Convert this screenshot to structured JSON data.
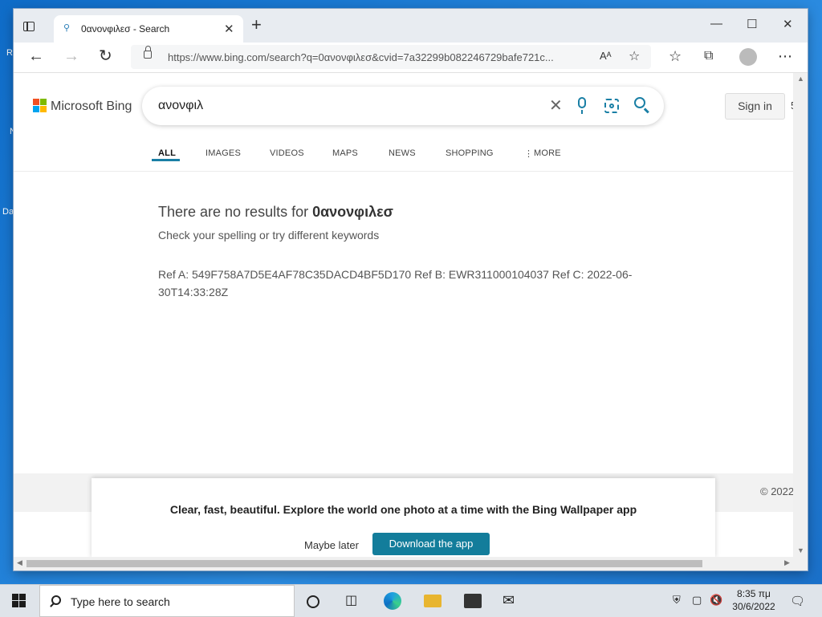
{
  "desktop": {
    "icon_labels": [
      "R",
      "N",
      "Da"
    ]
  },
  "browser": {
    "tab_title": "0ανονφιλεσ - Search",
    "url": "https://www.bing.com/search?q=0ανονφιλεσ&cvid=7a32299b082246729bafe721c...",
    "read_aloud": "Aᴬ"
  },
  "bing": {
    "logo_text": "Microsoft Bing",
    "logo_colors": [
      "#f25022",
      "#7fba00",
      "#00a4ef",
      "#ffb900"
    ],
    "search_query": "ανονφιλ",
    "sign_in": "Sign in",
    "sign_in_extra": "5",
    "nav": [
      "ALL",
      "IMAGES",
      "VIDEOS",
      "MAPS",
      "NEWS",
      "SHOPPING",
      "MORE"
    ],
    "no_results_prefix": "There are no results for ",
    "no_results_query": "0ανονφιλεσ",
    "hint": "Check your spelling or try different keywords",
    "ref_text": "Ref A: 549F758A7D5E4AF78C35DACD4BF5D170 Ref B: EWR311000104037 Ref C: 2022-06-30T14:33:28Z",
    "footer_copy": "© 2022"
  },
  "promo": {
    "text": "Clear, fast, beautiful. Explore the world one photo at a time with the Bing Wallpaper app",
    "maybe_later": "Maybe later",
    "download": "Download the app"
  },
  "taskbar": {
    "search_placeholder": "Type here to search",
    "time": "8:35 πμ",
    "date": "30/6/2022"
  },
  "colors": {
    "accent": "#137d9b",
    "taskbar": "#dfe4ea",
    "desktop": "#1a73c6"
  }
}
